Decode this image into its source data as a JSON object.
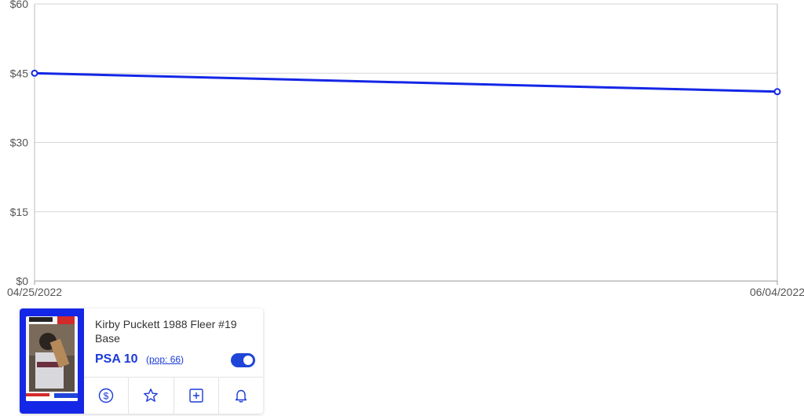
{
  "chart_data": {
    "type": "line",
    "x": [
      "04/25/2022",
      "06/04/2022"
    ],
    "series": [
      {
        "values": [
          45,
          41
        ]
      }
    ],
    "y_ticks": [
      "$0",
      "$15",
      "$30",
      "$45",
      "$60"
    ],
    "y_tick_values": [
      0,
      15,
      30,
      45,
      60
    ],
    "x_tick_labels": [
      "04/25/2022",
      "06/04/2022"
    ],
    "ylim": [
      0,
      60
    ],
    "grid": true,
    "line_color": "#1427e6"
  },
  "card": {
    "title": "Kirby Puckett 1988 Fleer #19 Base",
    "grade": "PSA 10",
    "pop_open": "(",
    "pop_link": "pop: 66",
    "pop_close": ")",
    "toggle_on": true,
    "image_bg": "#1427e6",
    "accent": "#1a3ad9",
    "actions": [
      {
        "name": "price-action-button",
        "icon": "dollar-icon"
      },
      {
        "name": "favorite-action-button",
        "icon": "star-icon"
      },
      {
        "name": "add-action-button",
        "icon": "plus-square-icon"
      },
      {
        "name": "alert-action-button",
        "icon": "bell-icon"
      }
    ]
  }
}
